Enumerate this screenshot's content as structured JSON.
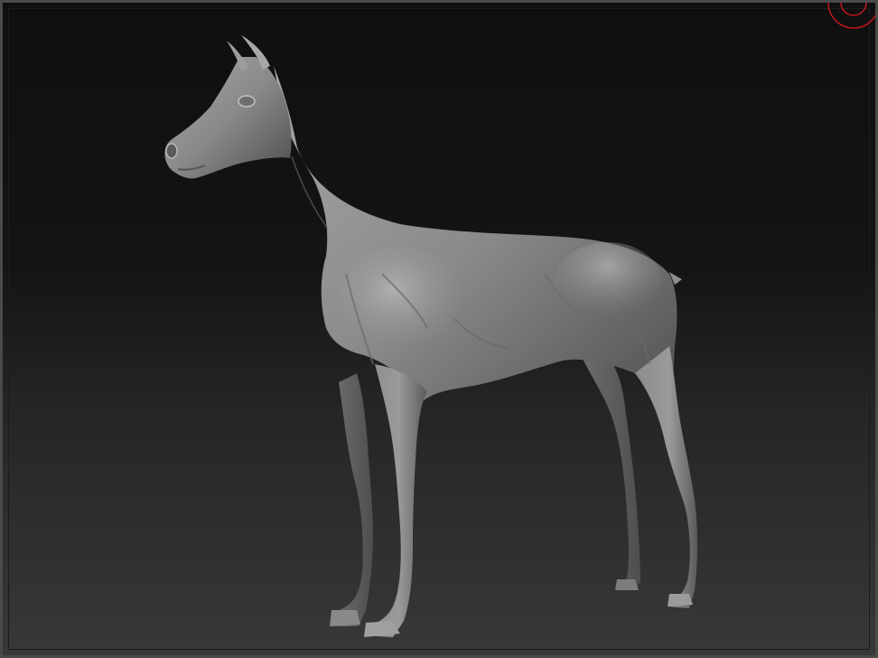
{
  "viewport": {
    "background_top": "#0f0f0f",
    "background_bottom": "#383838",
    "frame_color": "#4a4a4a"
  },
  "model": {
    "subject": "horse",
    "material_color": "#8a8a8a"
  },
  "gizmo": {
    "icon": "navigation-gizmo-icon",
    "color": "#c0161c"
  }
}
